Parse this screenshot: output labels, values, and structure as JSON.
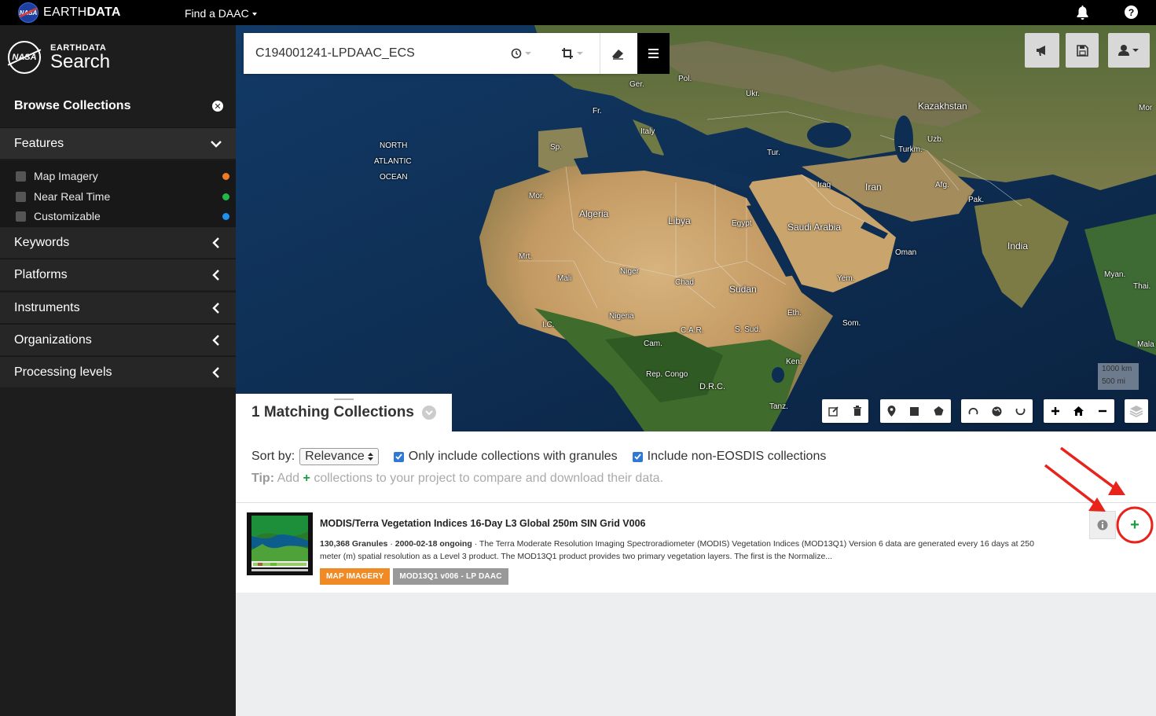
{
  "topbar": {
    "nasa_logo_text": "NASA",
    "brand_prefix": "EARTH",
    "brand_bold": "DATA",
    "daac_label": "Find a DAAC"
  },
  "sidebar": {
    "logo_small": "EARTHDATA",
    "logo_big": "Search",
    "logo_circle_text": "NASA",
    "browse_title": "Browse Collections",
    "features_label": "Features",
    "features": [
      {
        "label": "Map Imagery",
        "color": "#f07b26"
      },
      {
        "label": "Near Real Time",
        "color": "#21b94a"
      },
      {
        "label": "Customizable",
        "color": "#1f8ff0"
      }
    ],
    "sections": [
      "Keywords",
      "Platforms",
      "Instruments",
      "Organizations",
      "Processing levels"
    ]
  },
  "search": {
    "query": "C194001241-LPDAAC_ECS"
  },
  "map": {
    "labels": [
      "NORTH",
      "ATLANTIC",
      "OCEAN",
      "Ger.",
      "Pol.",
      "Ukr.",
      "Kazakhstan",
      "Fr.",
      "Italy",
      "Sp.",
      "Tur.",
      "Turkm.",
      "Uzb.",
      "Mor.",
      "Algeria",
      "Libya",
      "Egypt",
      "Iraq",
      "Iran",
      "Afg.",
      "Pak.",
      "Saudi Arabia",
      "India",
      "Mrt.",
      "Mali",
      "Niger",
      "Chad",
      "Sudan",
      "Oman",
      "Yem.",
      "Myan.",
      "Thai.",
      "Nigeria",
      "I.C.",
      "C.A.R.",
      "S. Sud.",
      "Eth.",
      "Som.",
      "Cam.",
      "Ken.",
      "Rep. Congo",
      "D.R.C.",
      "Tanz.",
      "Mor",
      "Mala"
    ],
    "scale_km": "1000 km",
    "scale_mi": "500 mi"
  },
  "results": {
    "count_title": "1 Matching Collections",
    "sort_label": "Sort by:",
    "sort_value": "Relevance",
    "filter_granules": "Only include collections with granules",
    "filter_non_eosdis": "Include non-EOSDIS collections",
    "tip_label": "Tip:",
    "tip_pre": "Add",
    "tip_post": "collections to your project to compare and download their data.",
    "tip_plus": "+"
  },
  "collection": {
    "title": "MODIS/Terra Vegetation Indices 16-Day L3 Global 250m SIN Grid V006",
    "granules": "130,368 Granules",
    "separator1": "·",
    "dates": "2000-02-18 ongoing",
    "separator2": "·",
    "description": "The Terra Moderate Resolution Imaging Spectroradiometer (MODIS) Vegetation Indices (MOD13Q1) Version 6 data are generated every 16 days at 250 meter (m) spatial resolution as a Level 3 product. The MOD13Q1 product provides two primary vegetation layers. The first is the Normalize...",
    "badges": [
      {
        "label": "MAP IMAGERY",
        "color": "#f08a24"
      },
      {
        "label": "MOD13Q1 v006 - LP DAAC",
        "color": "#999999"
      }
    ],
    "add_symbol": "+"
  },
  "colors": {
    "accent_green": "#1a9e3f",
    "annotation_red": "#e8231c",
    "checkbox_blue": "#2f78d4"
  }
}
